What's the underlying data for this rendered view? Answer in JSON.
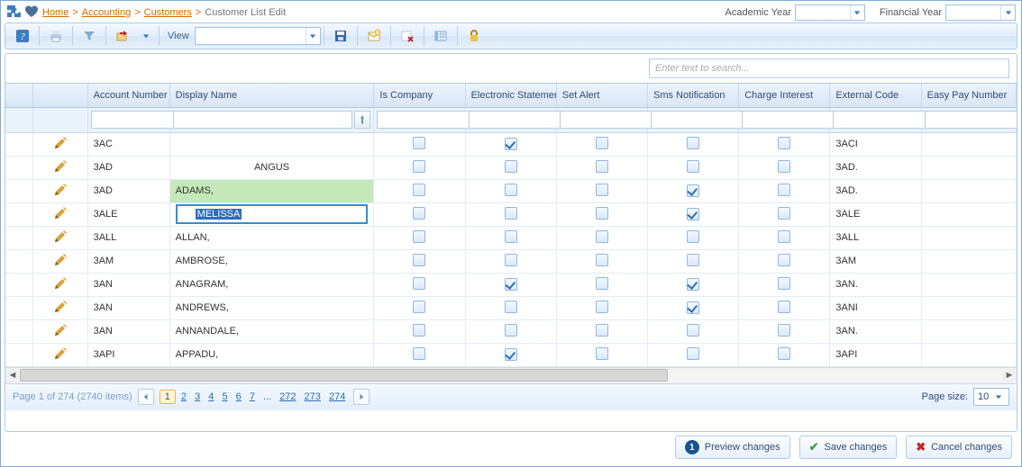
{
  "breadcrumb": {
    "home": "Home",
    "accounting": "Accounting",
    "customers": "Customers",
    "current": "Customer List Edit"
  },
  "header": {
    "academic_year_label": "Academic Year",
    "financial_year_label": "Financial Year"
  },
  "toolbar": {
    "view_label": "View"
  },
  "search": {
    "placeholder": "Enter text to search..."
  },
  "columns": {
    "account": "Account Number",
    "display": "Display Name",
    "iscompany": "Is Company",
    "estmt": "Electronic Statement",
    "alert": "Set Alert",
    "sms": "Sms Notification",
    "charge": "Charge Interest",
    "ext": "External Code",
    "easy": "Easy Pay Number"
  },
  "rows": [
    {
      "acct": "3AC",
      "name": "",
      "iscompany": false,
      "estmt": true,
      "alert": false,
      "sms": false,
      "chg": false,
      "ext": "3ACI",
      "name_modified": false,
      "editing": false
    },
    {
      "acct": "3AD",
      "name": "ANGUS",
      "name_align": "center",
      "iscompany": false,
      "estmt": false,
      "alert": false,
      "sms": false,
      "chg": false,
      "ext": "3AD.",
      "name_modified": false,
      "editing": false
    },
    {
      "acct": "3AD",
      "name": "ADAMS,",
      "iscompany": false,
      "estmt": false,
      "alert": false,
      "sms": true,
      "chg": false,
      "ext": "3AD.",
      "name_modified": true,
      "editing": false
    },
    {
      "acct": "3ALE",
      "name": "MELISSA",
      "iscompany": false,
      "estmt": false,
      "alert": false,
      "sms": true,
      "chg": false,
      "ext": "3ALE",
      "name_modified": false,
      "editing": true
    },
    {
      "acct": "3ALL",
      "name": "ALLAN,",
      "iscompany": false,
      "estmt": false,
      "alert": false,
      "sms": false,
      "chg": false,
      "ext": "3ALL",
      "name_modified": false,
      "editing": false
    },
    {
      "acct": "3AM",
      "name": "AMBROSE,",
      "iscompany": false,
      "estmt": false,
      "alert": false,
      "sms": false,
      "chg": false,
      "ext": "3AM",
      "name_modified": false,
      "editing": false
    },
    {
      "acct": "3AN",
      "name": "ANAGRAM,",
      "iscompany": false,
      "estmt": true,
      "alert": false,
      "sms": true,
      "chg": false,
      "ext": "3AN.",
      "name_modified": false,
      "editing": false
    },
    {
      "acct": "3AN",
      "name": "ANDREWS,",
      "iscompany": false,
      "estmt": false,
      "alert": false,
      "sms": true,
      "chg": false,
      "ext": "3ANI",
      "name_modified": false,
      "editing": false
    },
    {
      "acct": "3AN",
      "name": "ANNANDALE,",
      "iscompany": false,
      "estmt": false,
      "alert": false,
      "sms": false,
      "chg": false,
      "ext": "3AN.",
      "name_modified": false,
      "editing": false
    },
    {
      "acct": "3API",
      "name": "APPADU,",
      "iscompany": false,
      "estmt": true,
      "alert": false,
      "sms": false,
      "chg": false,
      "ext": "3API",
      "name_modified": false,
      "editing": false
    }
  ],
  "pager": {
    "info": "Page 1 of 274 (2740 items)",
    "pages": [
      "1",
      "2",
      "3",
      "4",
      "5",
      "6",
      "7"
    ],
    "ellipsis": "...",
    "tail": [
      "272",
      "273",
      "274"
    ],
    "page_size_label": "Page size:",
    "page_size": "10"
  },
  "footer": {
    "preview_badge": "1",
    "preview": "Preview changes",
    "save": "Save changes",
    "cancel": "Cancel changes"
  }
}
